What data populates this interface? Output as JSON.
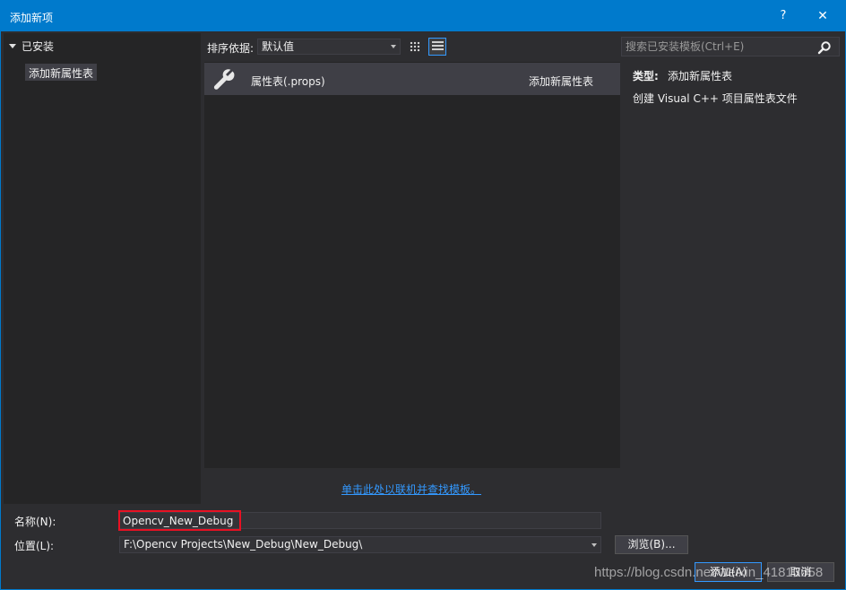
{
  "window": {
    "title": "添加新项",
    "help_label": "?",
    "close_label": "✕",
    "accent_color": "#007acc"
  },
  "tree": {
    "root_label": "已安装",
    "items": [
      {
        "label": "添加新属性表",
        "selected": true
      }
    ]
  },
  "toolbar": {
    "sort_label": "排序依据:",
    "sort_value": "默认值",
    "view_mode": "list"
  },
  "search": {
    "placeholder": "搜索已安装模板(Ctrl+E)",
    "icon": "search-icon"
  },
  "templates": [
    {
      "name": "属性表(.props)",
      "type": "添加新属性表",
      "icon": "wrench-icon",
      "selected": true
    }
  ],
  "info": {
    "type_label": "类型:",
    "type_value": "添加新属性表",
    "description": "创建 Visual C++ 项目属性表文件"
  },
  "online_link": "单击此处以联机并查找模板。",
  "form": {
    "name_label": "名称(N):",
    "name_value": "Opencv_New_Debug",
    "location_label": "位置(L):",
    "location_value": "F:\\Opencv Projects\\New_Debug\\New_Debug\\",
    "browse_label": "浏览(B)...",
    "highlight_color": "#e81123"
  },
  "buttons": {
    "add_label": "添加(A)",
    "cancel_label": "取消"
  },
  "watermark": "https://blog.csdn.net/weixin_41813658"
}
